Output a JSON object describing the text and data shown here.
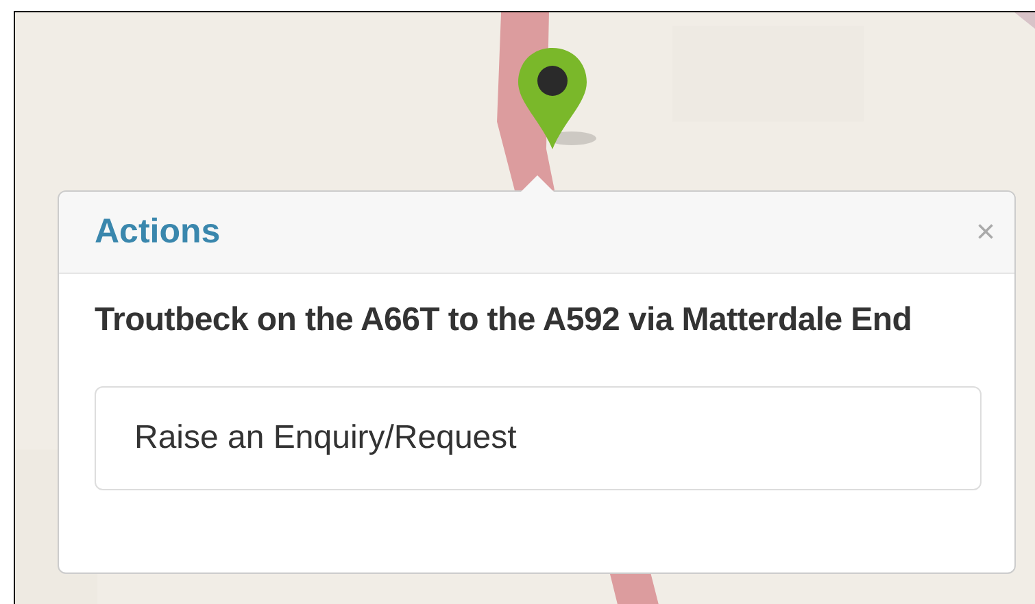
{
  "popup": {
    "title": "Actions",
    "close": "×",
    "heading": "Troutbeck on the A66T to the A592 via Matterdale End",
    "actions": [
      {
        "label": "Raise an Enquiry/Request"
      }
    ]
  }
}
